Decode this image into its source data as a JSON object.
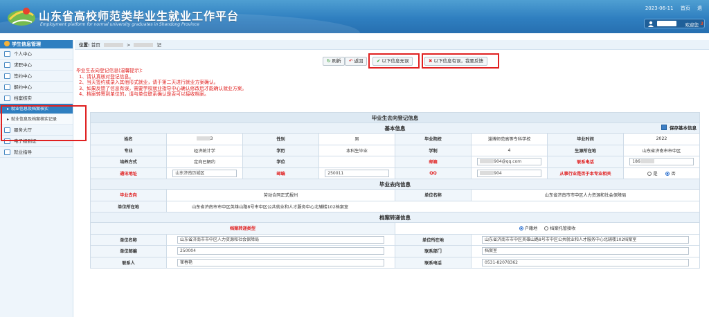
{
  "header": {
    "title": "山东省高校师范类毕业生就业工作平台",
    "subtitle": "Employment platform for normal university graduates in Shandong Province",
    "date": "2023-06-11",
    "home_link": "首页",
    "more_link": "退",
    "welcome": "欢迎您",
    "accent_char": "3"
  },
  "sidebar": {
    "header": "学生信息管理",
    "items": [
      {
        "label": "个人中心"
      },
      {
        "label": "求职中心"
      },
      {
        "label": "签约中心"
      },
      {
        "label": "解约中心"
      },
      {
        "label": "档案核实"
      }
    ],
    "subitems": [
      {
        "label": "就业信息及档案核实"
      },
      {
        "label": "就业信息及档案核实记录"
      }
    ],
    "items_after": [
      {
        "label": "服务大厅"
      },
      {
        "label": "电子报到证"
      },
      {
        "label": "就业指导"
      }
    ]
  },
  "breadcrumb": {
    "label": "位置:",
    "home": "首页",
    "sep": ">",
    "last": "记"
  },
  "toolbar": {
    "refresh": "刷新",
    "back": "返回",
    "confirm": "以下信息无误",
    "feedback": "以下信息有误，我要反馈"
  },
  "notice": {
    "title": "毕业生去向登记信息(温馨提示):",
    "lines": [
      "1、请认真核对登记信息。",
      "2、当天签约或录入其他形式就业，请于第二天进行就业方案确认。",
      "3、如果反馈了信息有误，需要学校就业指导中心确认修改后才能确认就业方案。",
      "4、档案转寄到单位的，请与单位联系确认是否可以接收档案。"
    ]
  },
  "form": {
    "title": "毕业生去向登记信息",
    "basic_section": "基本信息",
    "save_label": "保存基本信息",
    "labels": {
      "name": "姓名",
      "gender": "性别",
      "school": "毕业院校",
      "grad_time": "毕业时间",
      "major": "专业",
      "edu": "学历",
      "duration": "学制",
      "origin": "生源所在地",
      "train_mode": "培养方式",
      "degree": "学位",
      "email": "邮箱",
      "phone": "联系电话",
      "address": "通讯地址",
      "zip": "邮编",
      "qq": "QQ",
      "related": "从事行业是否于本专业相关"
    },
    "values": {
      "name_tail": "3",
      "gender": "男",
      "school": "淄博师范高等专科学校",
      "grad_time": "2022",
      "major": "经济统计学",
      "edu": "本科生毕业",
      "duration": "4",
      "origin": "山东省济南市市中区",
      "train_mode": "定向已解约",
      "degree": "",
      "email_tail": "904@qq.com",
      "phone_head": "186",
      "address": "山东济南历城区",
      "zip": "250011",
      "qq_tail": "904",
      "related_yes": "是",
      "related_no": "否"
    },
    "dest_section": "毕业去向信息",
    "dest_labels": {
      "dest": "毕业去向",
      "unit_name": "单位名称",
      "unit_loc": "单位所在地"
    },
    "dest_values": {
      "dest": "劳动合同正式报州",
      "unit_name": "山东省济南市市中区人力资源和社会保障局",
      "unit_loc": "山东省济南市市中区英雄山路8号市中区公共就业和人才服务中心北辅楼102档案室"
    },
    "archive_section": "档案转递信息",
    "archive_labels": {
      "type": "档案转递类型",
      "unit_name": "单位名称",
      "unit_loc": "单位所在地",
      "unit_zip": "单位邮编",
      "dept": "联系部门",
      "contact": "联系人",
      "tel": "联系电话"
    },
    "archive_values": {
      "opt1": "户籍地",
      "opt2": "档案托管接收",
      "unit_name": "山东省济南市市中区人力资源和社会保障局",
      "unit_loc": "山东省济南市市中区英雄山路8号市中区公共就业和人才服务中心北辅楼102档案室",
      "unit_zip": "250004",
      "dept": "档案室",
      "contact": "崔春艳",
      "tel": "0531-82078362"
    }
  }
}
